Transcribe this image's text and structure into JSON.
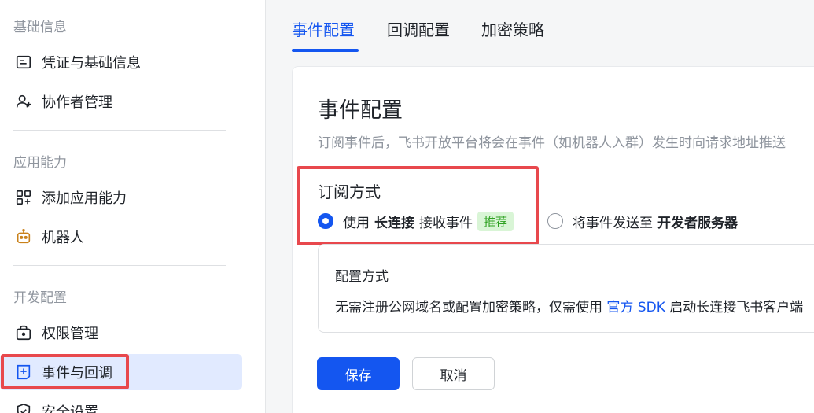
{
  "sidebar": {
    "sections": [
      {
        "title": "基础信息"
      },
      {
        "title": "应用能力"
      },
      {
        "title": "开发配置"
      }
    ],
    "items": [
      {
        "label": "凭证与基础信息",
        "icon": "credential-icon"
      },
      {
        "label": "协作者管理",
        "icon": "user-plus-icon"
      },
      {
        "label": "添加应用能力",
        "icon": "grid-plus-icon"
      },
      {
        "label": "机器人",
        "icon": "robot-icon"
      },
      {
        "label": "权限管理",
        "icon": "lock-bag-icon"
      },
      {
        "label": "事件与回调",
        "icon": "event-plus-icon",
        "active": true
      },
      {
        "label": "安全设置",
        "icon": "shield-icon"
      }
    ]
  },
  "tabs": [
    {
      "label": "事件配置",
      "active": true
    },
    {
      "label": "回调配置"
    },
    {
      "label": "加密策略"
    }
  ],
  "card": {
    "title": "事件配置",
    "description": "订阅事件后，飞书开放平台将会在事件（如机器人入群）发生时向请求地址推送",
    "subscribe": {
      "label": "订阅方式",
      "option1": {
        "prefix": "使用",
        "bold": "长连接",
        "suffix": "接收事件",
        "badge": "推荐",
        "checked": true
      },
      "option2": {
        "prefix": "将事件发送至",
        "bold": "开发者服务器",
        "checked": false
      }
    },
    "config": {
      "title": "配置方式",
      "text_before": "无需注册公网域名或配置加密策略，仅需使用",
      "link": "官方 SDK",
      "text_after": "启动长连接飞书客户端"
    },
    "buttons": {
      "save": "保存",
      "cancel": "取消"
    }
  },
  "colors": {
    "accent": "#1456f0",
    "annotation": "#e8484d",
    "badge_bg": "#d9f5d6",
    "badge_fg": "#2ea121"
  }
}
